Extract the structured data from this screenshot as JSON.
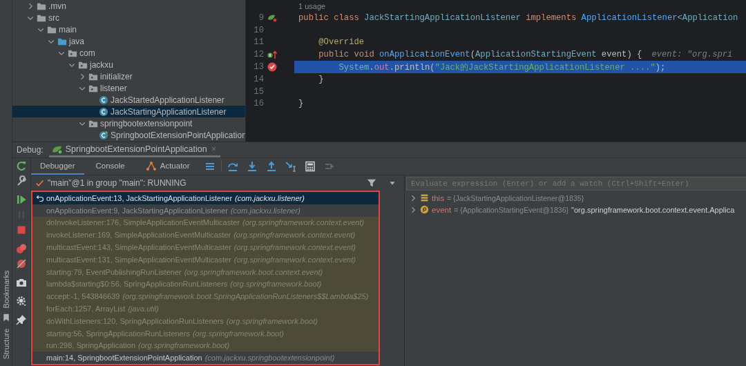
{
  "project_tree": {
    "items": [
      {
        "label": ".mvn",
        "kind": "folder",
        "expanded": false,
        "selected": false
      },
      {
        "label": "src",
        "kind": "folder",
        "expanded": true,
        "selected": false,
        "children": [
          {
            "label": "main",
            "kind": "folder",
            "expanded": true,
            "selected": false,
            "children": [
              {
                "label": "java",
                "kind": "source-root",
                "expanded": true,
                "selected": false,
                "children": [
                  {
                    "label": "com",
                    "kind": "package",
                    "expanded": true,
                    "selected": false,
                    "children": [
                      {
                        "label": "jackxu",
                        "kind": "package",
                        "expanded": true,
                        "selected": false,
                        "children": [
                          {
                            "label": "initializer",
                            "kind": "package",
                            "expanded": false,
                            "selected": false
                          },
                          {
                            "label": "listener",
                            "kind": "package",
                            "expanded": true,
                            "selected": false,
                            "children": [
                              {
                                "label": "JackStartedApplicationListener",
                                "kind": "class",
                                "selected": false
                              },
                              {
                                "label": "JackStartingApplicationListener",
                                "kind": "class",
                                "selected": true
                              }
                            ]
                          },
                          {
                            "label": "springbootextensionpoint",
                            "kind": "package",
                            "expanded": true,
                            "selected": false,
                            "children": [
                              {
                                "label": "SpringbootExtensionPointApplication",
                                "kind": "spring-class",
                                "selected": false
                              }
                            ]
                          }
                        ]
                      }
                    ]
                  }
                ]
              }
            ]
          }
        ]
      }
    ]
  },
  "editor": {
    "usage_hint": "1 usage",
    "lines": [
      {
        "number": "9",
        "kind": "spring-bean",
        "current": false,
        "tokens": [
          {
            "text": "public class ",
            "kind": "keyword"
          },
          {
            "text": "JackStartingApplicationListener ",
            "kind": "class"
          },
          {
            "text": "implements ",
            "kind": "keyword"
          },
          {
            "text": "ApplicationListener",
            "kind": "interface"
          },
          {
            "text": "<Application",
            "kind": "class"
          }
        ]
      },
      {
        "number": "10",
        "kind": "plain",
        "current": false
      },
      {
        "number": "11",
        "kind": "plain",
        "current": false,
        "tokens": [
          {
            "text": "    @Override",
            "kind": "annotation"
          }
        ]
      },
      {
        "number": "12",
        "kind": "implements",
        "current": false,
        "tokens": [
          {
            "text": "    public void ",
            "kind": "keyword"
          },
          {
            "text": "onApplicationEvent",
            "kind": "method"
          },
          {
            "text": "(",
            "kind": "plain"
          },
          {
            "text": "ApplicationStartingEvent",
            "kind": "class"
          },
          {
            "text": " event) {",
            "kind": "plain"
          }
        ],
        "inlay_hint": "event: \"org.spri"
      },
      {
        "number": "13",
        "kind": "breakpoint",
        "current": true,
        "tokens": [
          {
            "text": "        System",
            "kind": "class"
          },
          {
            "text": ".",
            "kind": "plain"
          },
          {
            "text": "out",
            "kind": "field"
          },
          {
            "text": ".println(",
            "kind": "plain"
          },
          {
            "text": "\"Jack的JackStartingApplicationListener ....\"",
            "kind": "string"
          },
          {
            "text": ");",
            "kind": "plain"
          }
        ]
      },
      {
        "number": "14",
        "kind": "plain",
        "current": false,
        "tokens": [
          {
            "text": "    }",
            "kind": "plain"
          }
        ]
      },
      {
        "number": "15",
        "kind": "plain",
        "current": false
      },
      {
        "number": "16",
        "kind": "plain",
        "current": false,
        "tokens": [
          {
            "text": "}",
            "kind": "plain"
          }
        ]
      }
    ]
  },
  "side_strip": [
    {
      "label": "Bookmarks"
    },
    {
      "label": "Structure"
    }
  ],
  "debug": {
    "label": "Debug:",
    "session": {
      "title": "SpringbootExtensionPointApplication",
      "close": "×"
    },
    "side_tools": [
      {
        "kind": "rerun",
        "disabled": false
      },
      {
        "kind": "settings",
        "disabled": false
      },
      {
        "kind": "resume",
        "disabled": false
      },
      {
        "kind": "pause",
        "disabled": true
      },
      {
        "kind": "stop",
        "disabled": false
      },
      {
        "kind": "view-breakpoints",
        "disabled": false
      },
      {
        "kind": "mute-breakpoints",
        "disabled": false
      },
      {
        "kind": "snapshot",
        "disabled": false
      },
      {
        "kind": "gear",
        "disabled": false
      },
      {
        "kind": "pin",
        "disabled": false
      }
    ],
    "tabs": [
      {
        "label": "Debugger",
        "kind": "plain",
        "selected": true
      },
      {
        "label": "Console",
        "kind": "plain",
        "selected": false
      },
      {
        "label": "Actuator",
        "kind": "actuator",
        "selected": false
      }
    ],
    "toolbar": [
      {
        "kind": "frames-menu",
        "disabled": false
      },
      {
        "kind": "step-over",
        "disabled": false
      },
      {
        "kind": "step-into",
        "disabled": false
      },
      {
        "kind": "step-out",
        "disabled": false
      },
      {
        "kind": "run-to-cursor",
        "disabled": false
      },
      {
        "kind": "evaluate",
        "disabled": false
      },
      {
        "kind": "trace",
        "disabled": true
      }
    ],
    "thread": "\"main\"@1 in group \"main\": RUNNING",
    "frames": {
      "highlighted": true,
      "items": [
        {
          "method": "onApplicationEvent:13, JackStartingApplicationListener",
          "package": "(com.jackxu.listener)",
          "selected": true,
          "library": false
        },
        {
          "method": "onApplicationEvent:9, JackStartingApplicationListener",
          "package": "(com.jackxu.listener)",
          "selected": false,
          "library": false
        },
        {
          "method": "doInvokeListener:176, SimpleApplicationEventMulticaster",
          "package": "(org.springframework.context.event)",
          "selected": false,
          "library": true
        },
        {
          "method": "invokeListener:169, SimpleApplicationEventMulticaster",
          "package": "(org.springframework.context.event)",
          "selected": false,
          "library": true
        },
        {
          "method": "multicastEvent:143, SimpleApplicationEventMulticaster",
          "package": "(org.springframework.context.event)",
          "selected": false,
          "library": true
        },
        {
          "method": "multicastEvent:131, SimpleApplicationEventMulticaster",
          "package": "(org.springframework.context.event)",
          "selected": false,
          "library": true
        },
        {
          "method": "starting:79, EventPublishingRunListener",
          "package": "(org.springframework.boot.context.event)",
          "selected": false,
          "library": true
        },
        {
          "method": "lambda$starting$0:56, SpringApplicationRunListeners",
          "package": "(org.springframework.boot)",
          "selected": false,
          "library": true
        },
        {
          "method": "accept:-1, 543846639",
          "package": "(org.springframework.boot.SpringApplicationRunListeners$$Lambda$25)",
          "selected": false,
          "library": true
        },
        {
          "method": "forEach:1257, ArrayList",
          "package": "(java.util)",
          "selected": false,
          "library": true
        },
        {
          "method": "doWithListeners:120, SpringApplicationRunListeners",
          "package": "(org.springframework.boot)",
          "selected": false,
          "library": true
        },
        {
          "method": "starting:56, SpringApplicationRunListeners",
          "package": "(org.springframework.boot)",
          "selected": false,
          "library": true
        },
        {
          "method": "run:298, SpringApplication",
          "package": "(org.springframework.boot)",
          "selected": false,
          "library": true
        },
        {
          "method": "main:14, SpringbootExtensionPointApplication",
          "package": "(com.jackxu.springbootextensionpoint)",
          "selected": false,
          "library": false
        }
      ]
    },
    "evaluate": {
      "placeholder": "Evaluate expression (Enter) or add a watch (Ctrl+Shift+Enter)"
    },
    "variables": [
      {
        "kind": "field",
        "name": "this",
        "value": "= {JackStartingApplicationListener@1835}"
      },
      {
        "kind": "parameter",
        "name": "event",
        "value": "= {ApplicationStartingEvent@1836}",
        "detail": "\"org.springframework.boot.context.event.Applica"
      }
    ]
  }
}
